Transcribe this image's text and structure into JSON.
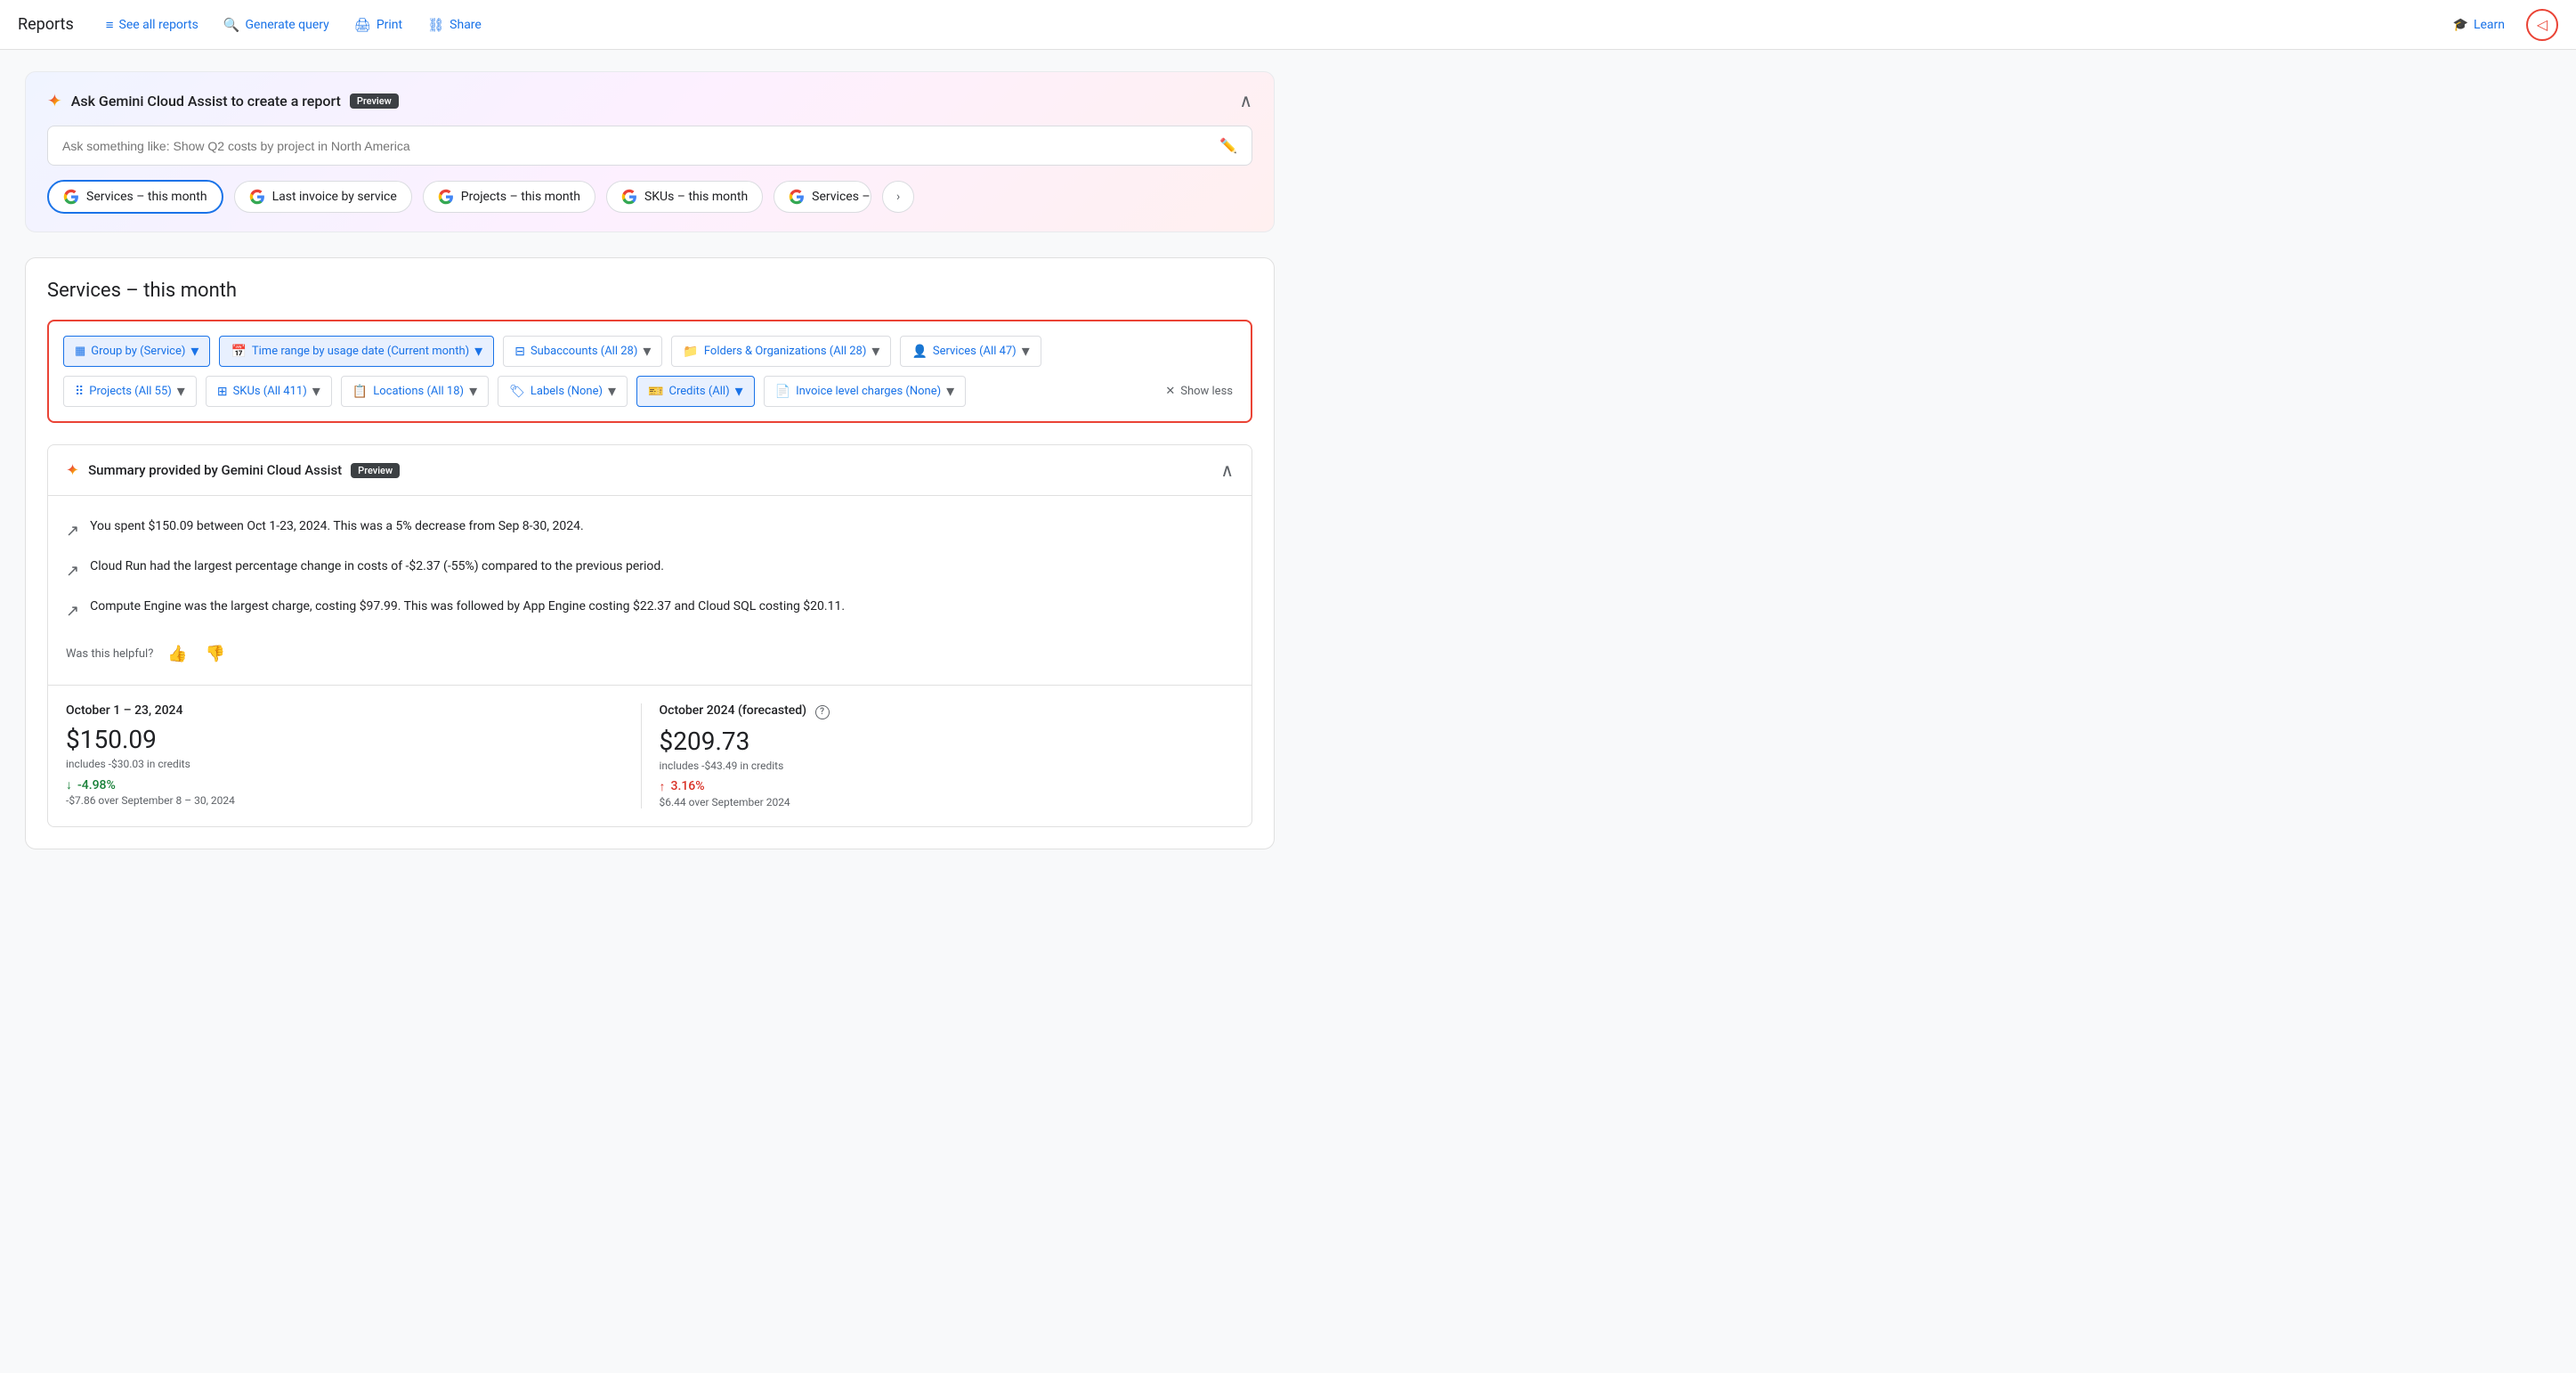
{
  "nav": {
    "title": "Reports",
    "links": [
      {
        "id": "see-all-reports",
        "label": "See all reports",
        "icon": "≡"
      },
      {
        "id": "generate-query",
        "label": "Generate query",
        "icon": "◎"
      },
      {
        "id": "print",
        "label": "Print",
        "icon": "⎙"
      },
      {
        "id": "share",
        "label": "Share",
        "icon": "↗"
      }
    ],
    "learn": "Learn"
  },
  "gemini": {
    "title": "Ask Gemini Cloud Assist to create a report",
    "preview_badge": "Preview",
    "input_placeholder": "Ask something like: Show Q2 costs by project in North America",
    "chips": [
      {
        "id": "services-month",
        "label": "Services – this month",
        "active": true
      },
      {
        "id": "last-invoice",
        "label": "Last invoice by service",
        "active": false
      },
      {
        "id": "projects-month",
        "label": "Projects – this month",
        "active": false
      },
      {
        "id": "skus-month",
        "label": "SKUs – this month",
        "active": false
      },
      {
        "id": "services-last",
        "label": "Services –",
        "active": false
      }
    ]
  },
  "report": {
    "title": "Services – this month",
    "filters": {
      "row1": [
        {
          "id": "group-by",
          "label": "Group by (Service)",
          "icon": "▦",
          "blue": true
        },
        {
          "id": "time-range",
          "label": "Time range by usage date (Current month)",
          "icon": "📅",
          "blue": true
        },
        {
          "id": "subaccounts",
          "label": "Subaccounts (All 28)",
          "icon": "⊟",
          "blue": false
        },
        {
          "id": "folders-orgs",
          "label": "Folders & Organizations (All 28)",
          "icon": "📁",
          "blue": false
        },
        {
          "id": "services",
          "label": "Services (All 47)",
          "icon": "👤",
          "blue": false
        }
      ],
      "row2": [
        {
          "id": "projects",
          "label": "Projects (All 55)",
          "icon": "•••",
          "blue": false
        },
        {
          "id": "skus",
          "label": "SKUs (All 411)",
          "icon": "▦",
          "blue": false
        },
        {
          "id": "locations",
          "label": "Locations (All 18)",
          "icon": "📋",
          "blue": false
        },
        {
          "id": "labels",
          "label": "Labels (None)",
          "icon": "🏷",
          "blue": false
        },
        {
          "id": "credits",
          "label": "Credits (All)",
          "icon": "🎫",
          "blue": true
        },
        {
          "id": "invoice-charges",
          "label": "Invoice level charges (None)",
          "icon": "📄",
          "blue": false
        }
      ],
      "show_less": "Show less"
    },
    "summary": {
      "title": "Summary provided by Gemini Cloud Assist",
      "preview_badge": "Preview",
      "items": [
        {
          "text": "You spent $150.09 between Oct 1-23, 2024. This was a 5% decrease from Sep 8-30, 2024."
        },
        {
          "text": "Cloud Run had the largest percentage change in costs of -$2.37 (-55%) compared to the previous period."
        },
        {
          "text": "Compute Engine was the largest charge, costing $97.99. This was followed by App Engine costing $22.37 and Cloud SQL costing $20.11."
        }
      ],
      "helpful_label": "Was this helpful?"
    },
    "metrics": {
      "current": {
        "period": "October 1 – 23, 2024",
        "value": "$150.09",
        "sub": "includes -$30.03 in credits",
        "change_value": "-4.98%",
        "change_direction": "down",
        "change_sub": "-$7.86 over September 8 – 30, 2024"
      },
      "forecasted": {
        "period": "October 2024 (forecasted)",
        "value": "$209.73",
        "sub": "includes -$43.49 in credits",
        "change_value": "3.16%",
        "change_direction": "up",
        "change_sub": "$6.44 over September 2024"
      }
    }
  }
}
